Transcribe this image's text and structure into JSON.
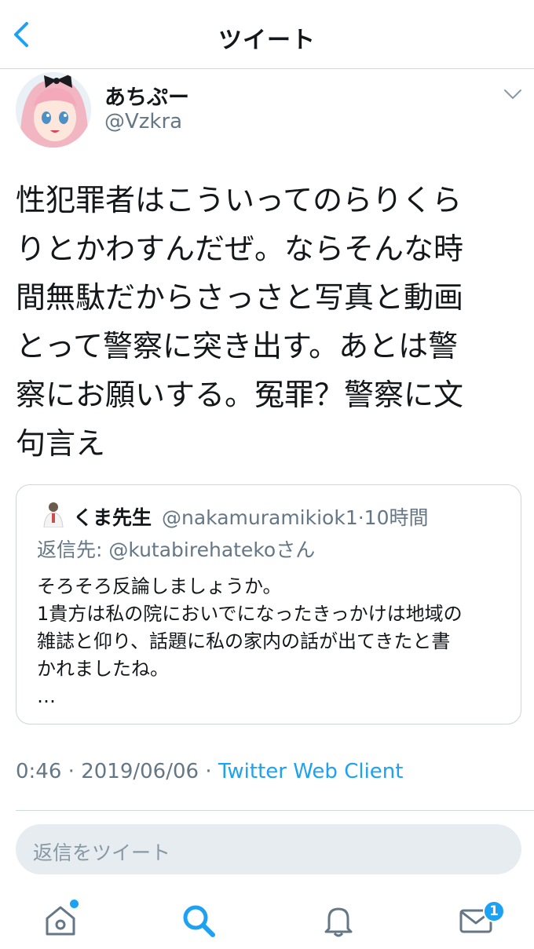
{
  "nav": {
    "title": "ツイート"
  },
  "tweet": {
    "display_name": "あちぷー",
    "handle": "@Vzkra",
    "text_lines": [
      "性犯罪者はこういってのらりくら",
      "りとかわすんだぜ。ならそんな時",
      "間無駄だからさっさと写真と動画",
      "とって警察に突き出す。あとは警",
      "察にお願いする。冤罪？警察に文",
      "句言え"
    ],
    "time": "0:46",
    "date": "2019/06/06",
    "source": "Twitter Web Client"
  },
  "quote": {
    "display_name": "くま先生",
    "handle_time": "@nakamuramikiok1·10時間",
    "reply_to": "返信先: @kutabirehatekoさん",
    "lines": [
      "そろそろ反論しましょうか。",
      "1貴方は私の院においでになったきっかけは地域の",
      "雑誌と仰り、話題に私の家内の話が出てきたと書",
      "かれましたね。",
      "…"
    ]
  },
  "reply": {
    "placeholder": "返信をツイート"
  },
  "tabs": {
    "messages_badge": "1"
  },
  "colors": {
    "accent": "#1da1f2",
    "secondary_text": "#657786",
    "reply_box": "#e6ecf0"
  },
  "icons": [
    "back-chevron-icon",
    "caret-down-icon",
    "home-icon",
    "search-icon",
    "bell-icon",
    "mail-icon"
  ]
}
